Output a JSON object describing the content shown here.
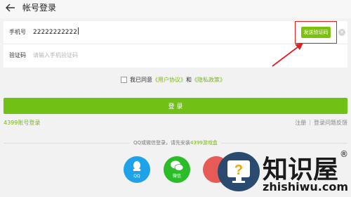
{
  "header": {
    "title": "帐号登录",
    "back_icon": "back-arrow-icon"
  },
  "form": {
    "phone_label": "手机号",
    "phone_value": "22222222222",
    "send_code_label": "发送验证码",
    "code_label": "验证码",
    "code_placeholder": "请输入手机验证码"
  },
  "agreement": {
    "prefix": "我已同意",
    "user_agreement": "《用户协议》",
    "and": "和",
    "privacy_policy": "《隐私政策》"
  },
  "login_button": "登 录",
  "account_login_link": "4399账号登录",
  "links": {
    "register": "注册",
    "separator": "|",
    "help": "登录问题反馈"
  },
  "social_hint": {
    "text": "QQ或微信登录，请先安装",
    "link": "4399游戏盒"
  },
  "social": [
    {
      "label": "QQ",
      "icon": "qq-icon"
    },
    {
      "label": "微信",
      "icon": "wechat-icon"
    },
    {
      "label": "",
      "icon": "weibo-icon"
    }
  ],
  "watermark": {
    "name": "知识屋",
    "domain": "zhishiwu.com",
    "mark": "®"
  },
  "colors": {
    "accent": "#70c015",
    "highlight": "#e02020"
  }
}
